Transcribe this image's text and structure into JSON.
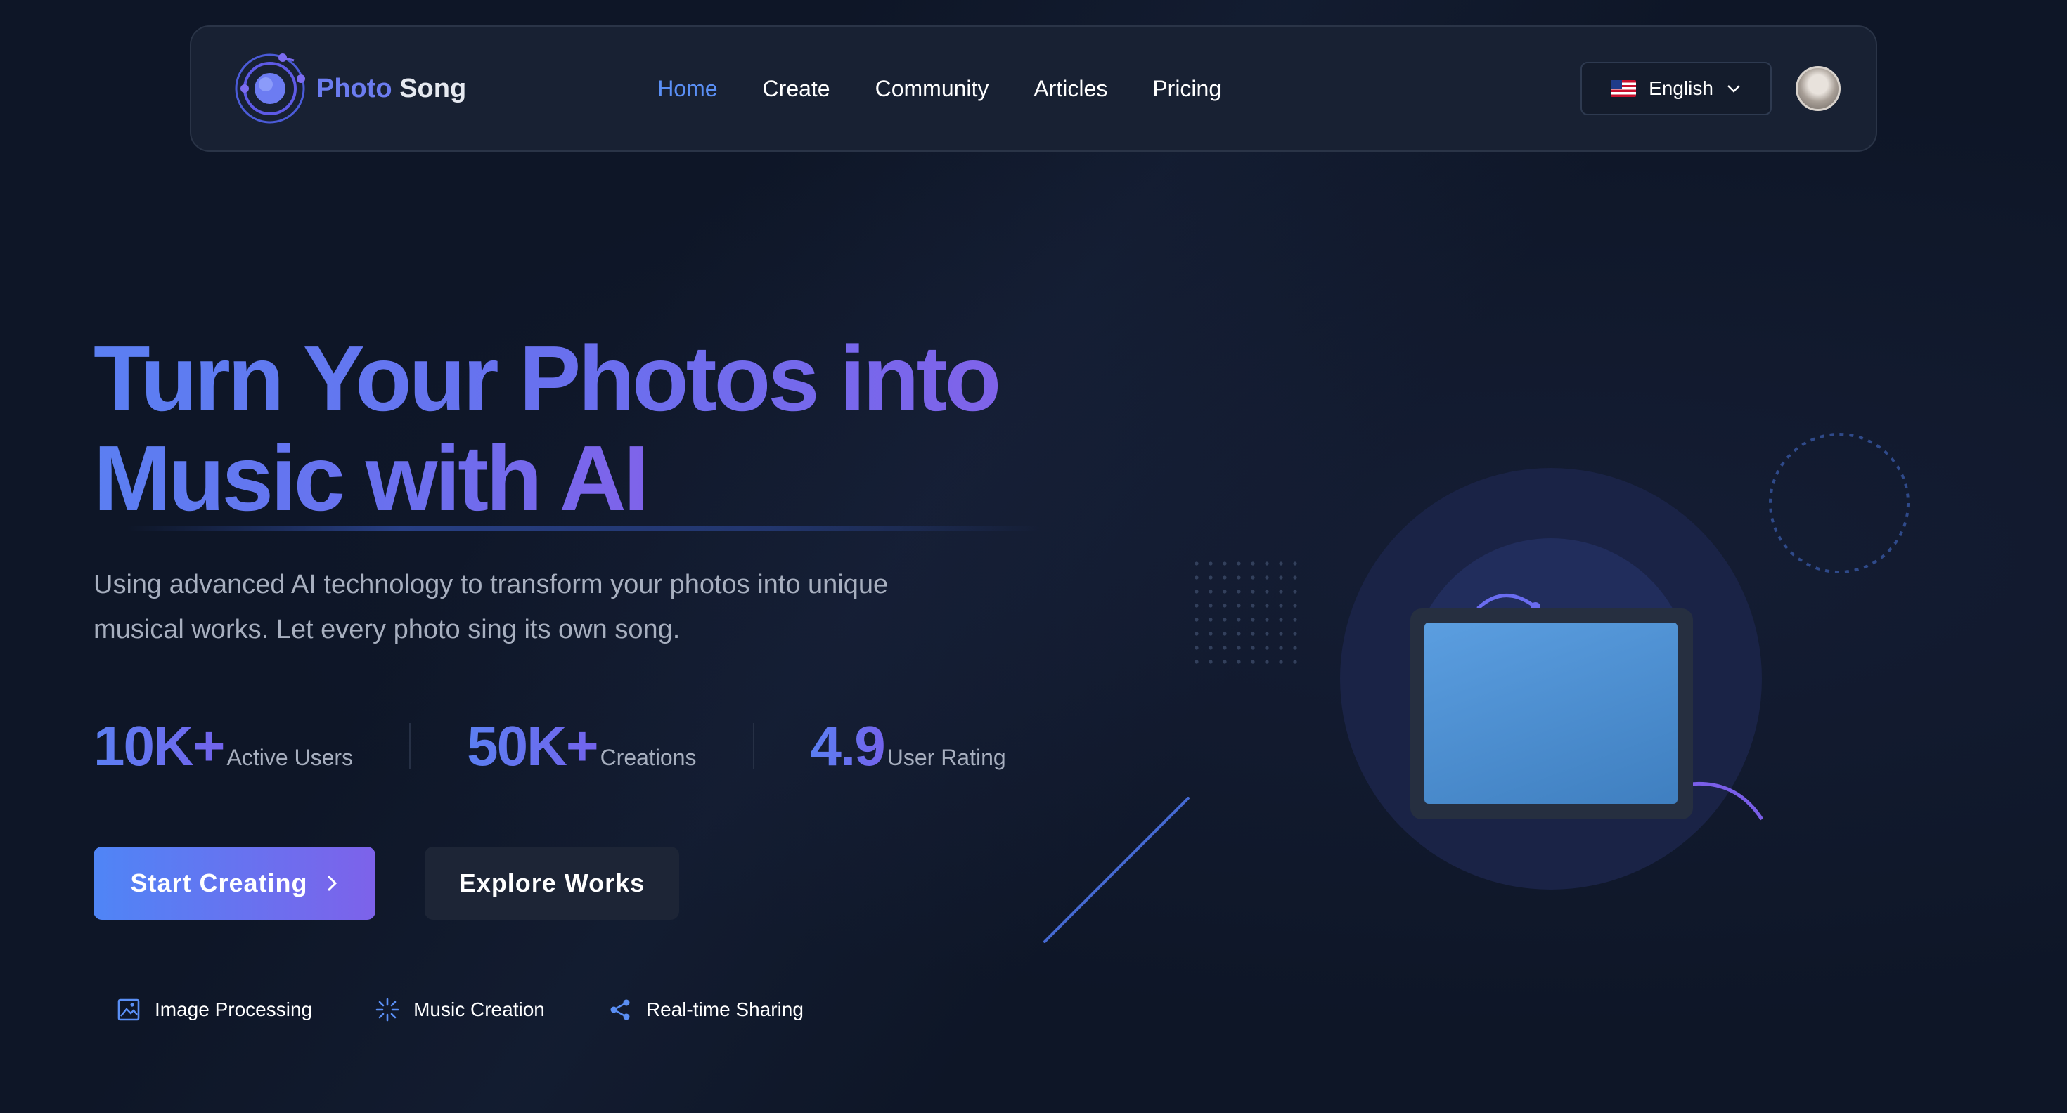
{
  "nav": {
    "brand_first": "Photo",
    "brand_second": "Song",
    "links": [
      "Home",
      "Create",
      "Community",
      "Articles",
      "Pricing"
    ],
    "active": "Home",
    "language": "English"
  },
  "hero": {
    "title_line1": "Turn Your Photos into",
    "title_line2": "Music with AI",
    "subtitle_line1": "Using advanced AI technology to transform your photos into unique",
    "subtitle_line2": "musical works. Let every photo sing its own song.",
    "stats": [
      {
        "value": "10K+",
        "label": "Active Users"
      },
      {
        "value": "50K+",
        "label": "Creations"
      },
      {
        "value": "4.9",
        "label": "User Rating"
      }
    ],
    "primary_button": "Start Creating",
    "secondary_button": "Explore Works",
    "features": [
      {
        "label": "Image Processing",
        "icon": "image-icon"
      },
      {
        "label": "Music Creation",
        "icon": "sparkle-icon"
      },
      {
        "label": "Real-time Sharing",
        "icon": "share-icon"
      }
    ]
  },
  "colors": {
    "background": "#0e1627",
    "accent_blue": "#5a8ff5",
    "accent_purple": "#7d62ea",
    "navbar_bg": "#182133"
  }
}
